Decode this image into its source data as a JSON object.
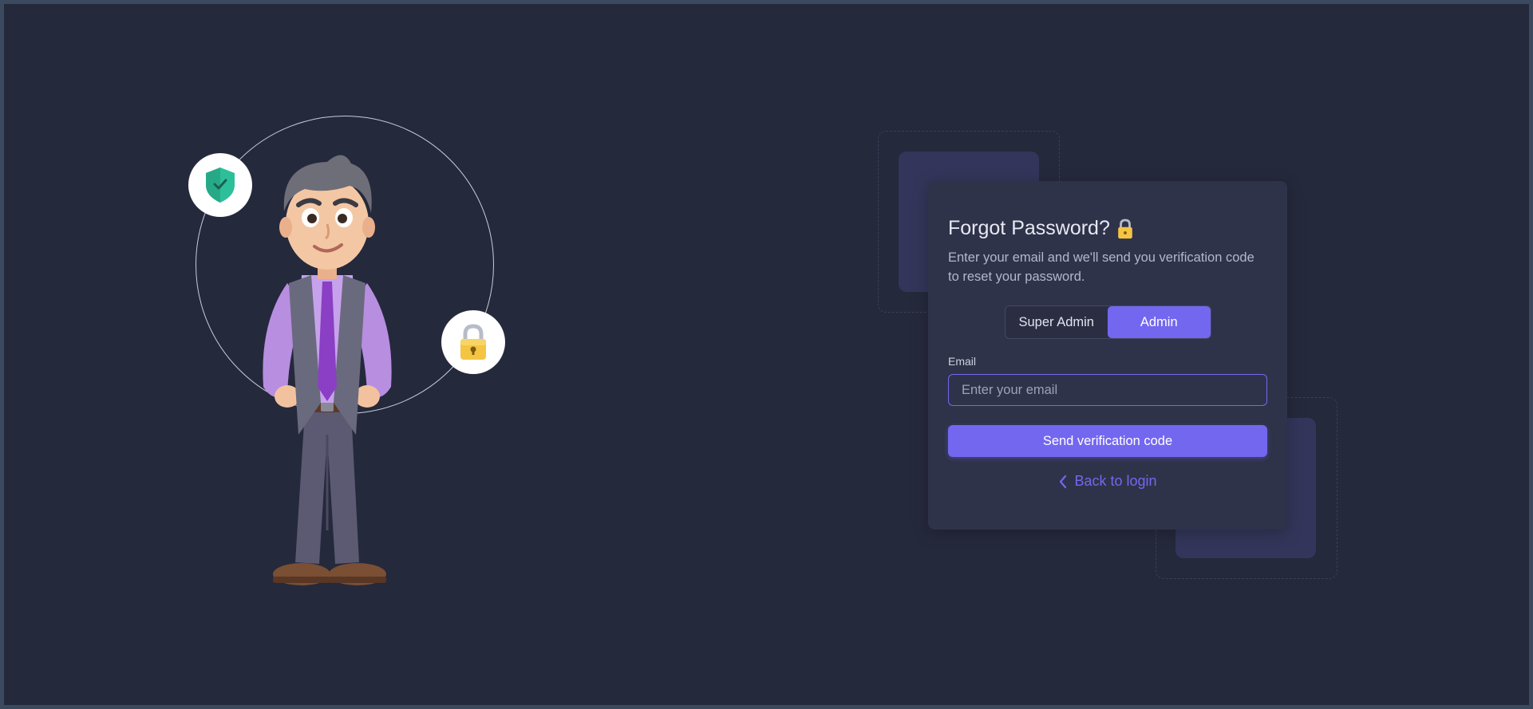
{
  "colors": {
    "background": "#25293c",
    "card": "#2f3349",
    "accent": "#7367f0",
    "text": "#e6e8f2",
    "muted": "#b3b6cc"
  },
  "illustration": {
    "icons": [
      "shield-check-icon",
      "padlock-icon",
      "person-illustration"
    ]
  },
  "card": {
    "title": "Forgot Password?",
    "title_icon": "padlock-icon",
    "subtitle": "Enter your email and we'll send you verification code to reset your password.",
    "roles": [
      {
        "label": "Super Admin",
        "active": false
      },
      {
        "label": "Admin",
        "active": true
      }
    ],
    "email": {
      "label": "Email",
      "placeholder": "Enter your email",
      "value": ""
    },
    "send_label": "Send verification code",
    "back_label": "Back to login",
    "back_icon": "chevron-left-icon"
  }
}
